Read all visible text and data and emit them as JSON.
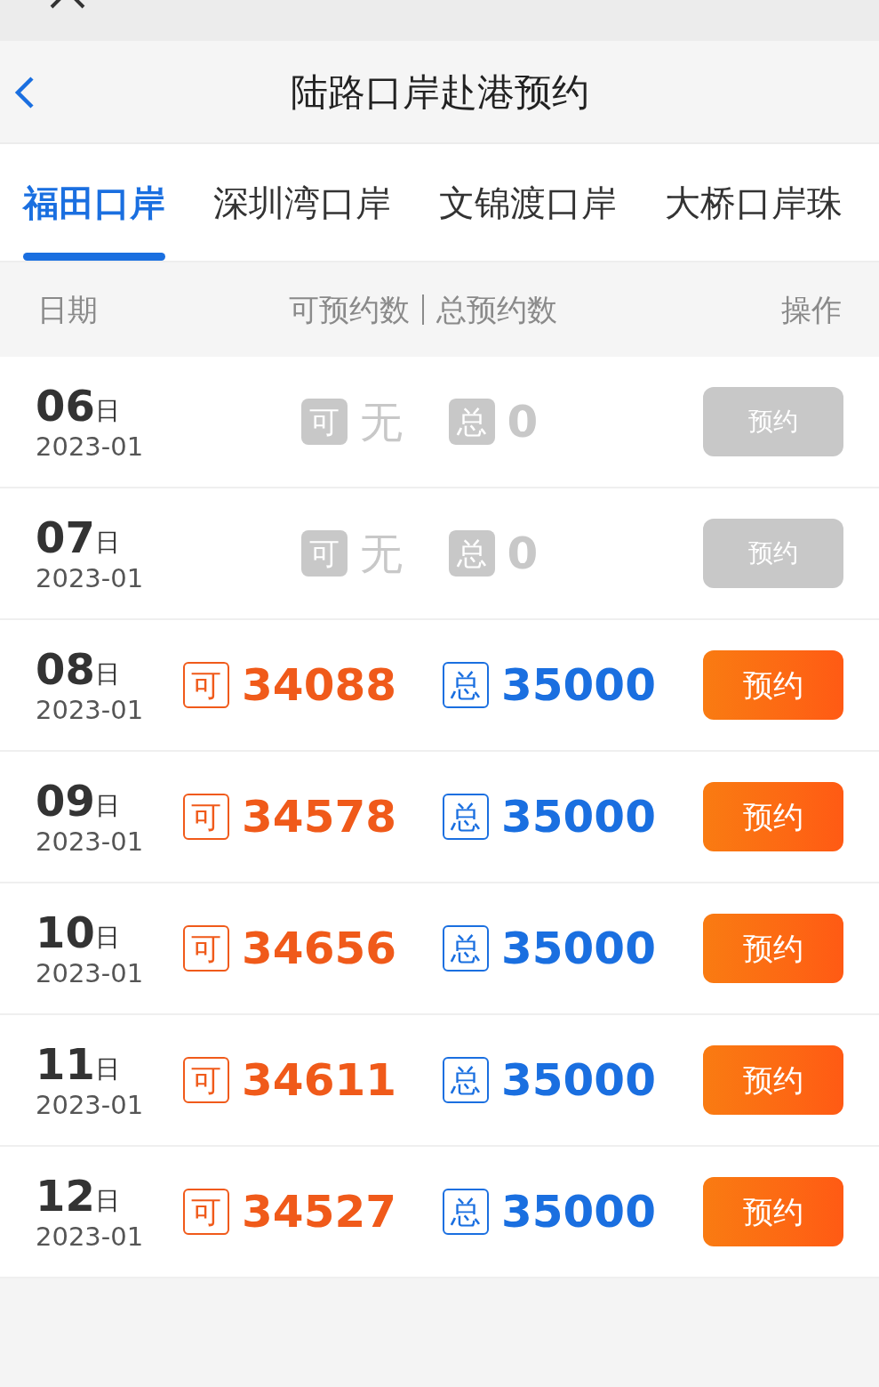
{
  "nav": {
    "title": "陆路口岸赴港预约"
  },
  "tabs": [
    {
      "label": "福田口岸",
      "selected": true
    },
    {
      "label": "深圳湾口岸",
      "selected": false
    },
    {
      "label": "文锦渡口岸",
      "selected": false
    },
    {
      "label": "大桥口岸珠",
      "selected": false
    }
  ],
  "table": {
    "columns": [
      "日期",
      "可预约数",
      "总预约数",
      "操作"
    ],
    "rows": [
      {
        "day": "06",
        "day_unit": "日",
        "month": "2023-01",
        "available_tag": "可",
        "available": "无",
        "total_tag": "总",
        "total": "0",
        "button": "预约",
        "disabled": true
      },
      {
        "day": "07",
        "day_unit": "日",
        "month": "2023-01",
        "available_tag": "可",
        "available": "无",
        "total_tag": "总",
        "total": "0",
        "button": "预约",
        "disabled": true
      },
      {
        "day": "08",
        "day_unit": "日",
        "month": "2023-01",
        "available_tag": "可",
        "available": "34088",
        "total_tag": "总",
        "total": "35000",
        "button": "预约",
        "disabled": false
      },
      {
        "day": "09",
        "day_unit": "日",
        "month": "2023-01",
        "available_tag": "可",
        "available": "34578",
        "total_tag": "总",
        "total": "35000",
        "button": "预约",
        "disabled": false
      },
      {
        "day": "10",
        "day_unit": "日",
        "month": "2023-01",
        "available_tag": "可",
        "available": "34656",
        "total_tag": "总",
        "total": "35000",
        "button": "预约",
        "disabled": false
      },
      {
        "day": "11",
        "day_unit": "日",
        "month": "2023-01",
        "available_tag": "可",
        "available": "34611",
        "total_tag": "总",
        "total": "35000",
        "button": "预约",
        "disabled": false
      },
      {
        "day": "12",
        "day_unit": "日",
        "month": "2023-01",
        "available_tag": "可",
        "available": "34527",
        "total_tag": "总",
        "total": "35000",
        "button": "预约",
        "disabled": false
      }
    ]
  }
}
